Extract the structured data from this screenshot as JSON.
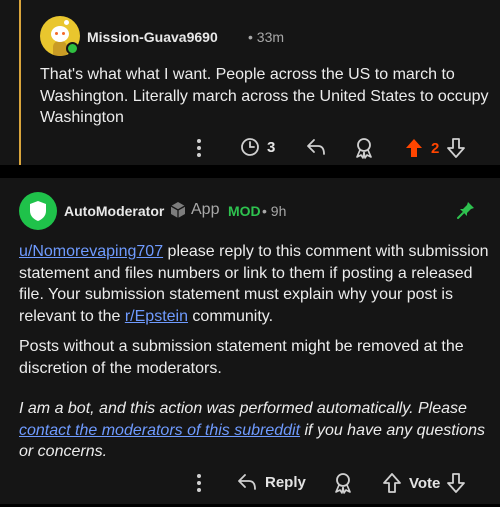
{
  "comment1": {
    "username": "Mission-Guava9690",
    "time": "• 33m",
    "body": "That's what what I want. People across the US to march to Washington. Literally march across the United States to occupy Washington",
    "awards_count": "3",
    "vote_count": "2",
    "colors": {
      "thread": "#d9a53c",
      "upvote": "#ff4500",
      "online": "#2fbf40"
    }
  },
  "comment2": {
    "username": "AutoModerator",
    "app_label": "App",
    "mod_label": "MOD",
    "time": "• 9h",
    "user_link": "u/Nomorevaping707",
    "p1_mid": " please reply to this comment with submission statement and files numbers or link to them if posting a released file. Your submission statement must explain why your post is relevant to the ",
    "sub_link": "r/Epstein",
    "p1_end": " community.",
    "p2": "Posts without a submission statement might be removed at the discretion of the moderators.",
    "p3_start": "I am a bot, and this action was performed automatically. Please ",
    "contact_link": "contact the moderators of this subreddit",
    "p3_end": " if you have any questions or concerns.",
    "reply_label": "Reply",
    "vote_label": "Vote",
    "colors": {
      "avatar": "#1fc24a",
      "mod": "#2ec24f",
      "link": "#6f9bff"
    }
  }
}
